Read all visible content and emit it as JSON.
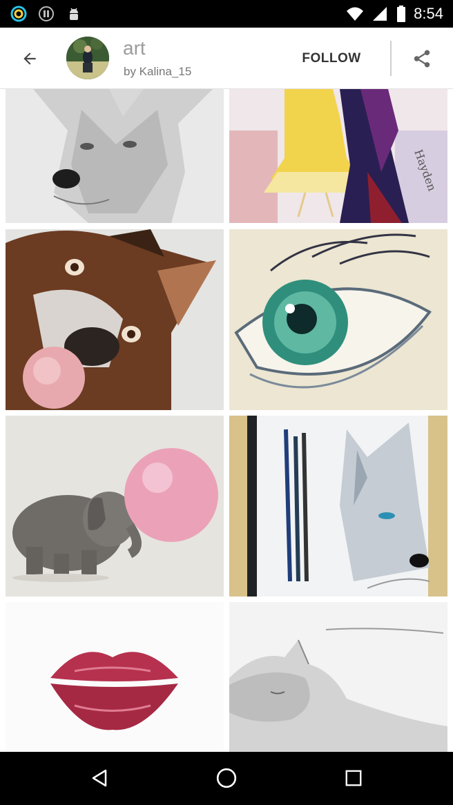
{
  "status_bar": {
    "time": "8:54",
    "left_icons": [
      "ring-app-icon",
      "info-circle-icon",
      "android-icon"
    ],
    "right_icons": [
      "wifi-icon",
      "cellular-signal-icon",
      "battery-icon"
    ]
  },
  "header": {
    "back_icon": "arrow-back-icon",
    "title": "art",
    "author": "by Kalina_15",
    "follow_label": "FOLLOW",
    "share_icon": "share-icon"
  },
  "pins": [
    {
      "subject": "wolf-pencil-sketch"
    },
    {
      "subject": "fashion-illustration"
    },
    {
      "subject": "boxer-dog-bubblegum"
    },
    {
      "subject": "green-eye-drawing"
    },
    {
      "subject": "elephant-bubblegum"
    },
    {
      "subject": "wolf-drawing-with-pencils"
    },
    {
      "subject": "red-lips-print"
    },
    {
      "subject": "sleeping-cat-sketch"
    }
  ],
  "navigation": {
    "back_icon": "nav-back-icon",
    "home_icon": "nav-home-icon",
    "recents_icon": "nav-recents-icon"
  },
  "colors": {
    "status_bar_bg": "#000000",
    "header_bg": "#ffffff",
    "title_text": "#9b9b9b",
    "follow_text": "#333333",
    "icon_gray": "#555555"
  }
}
